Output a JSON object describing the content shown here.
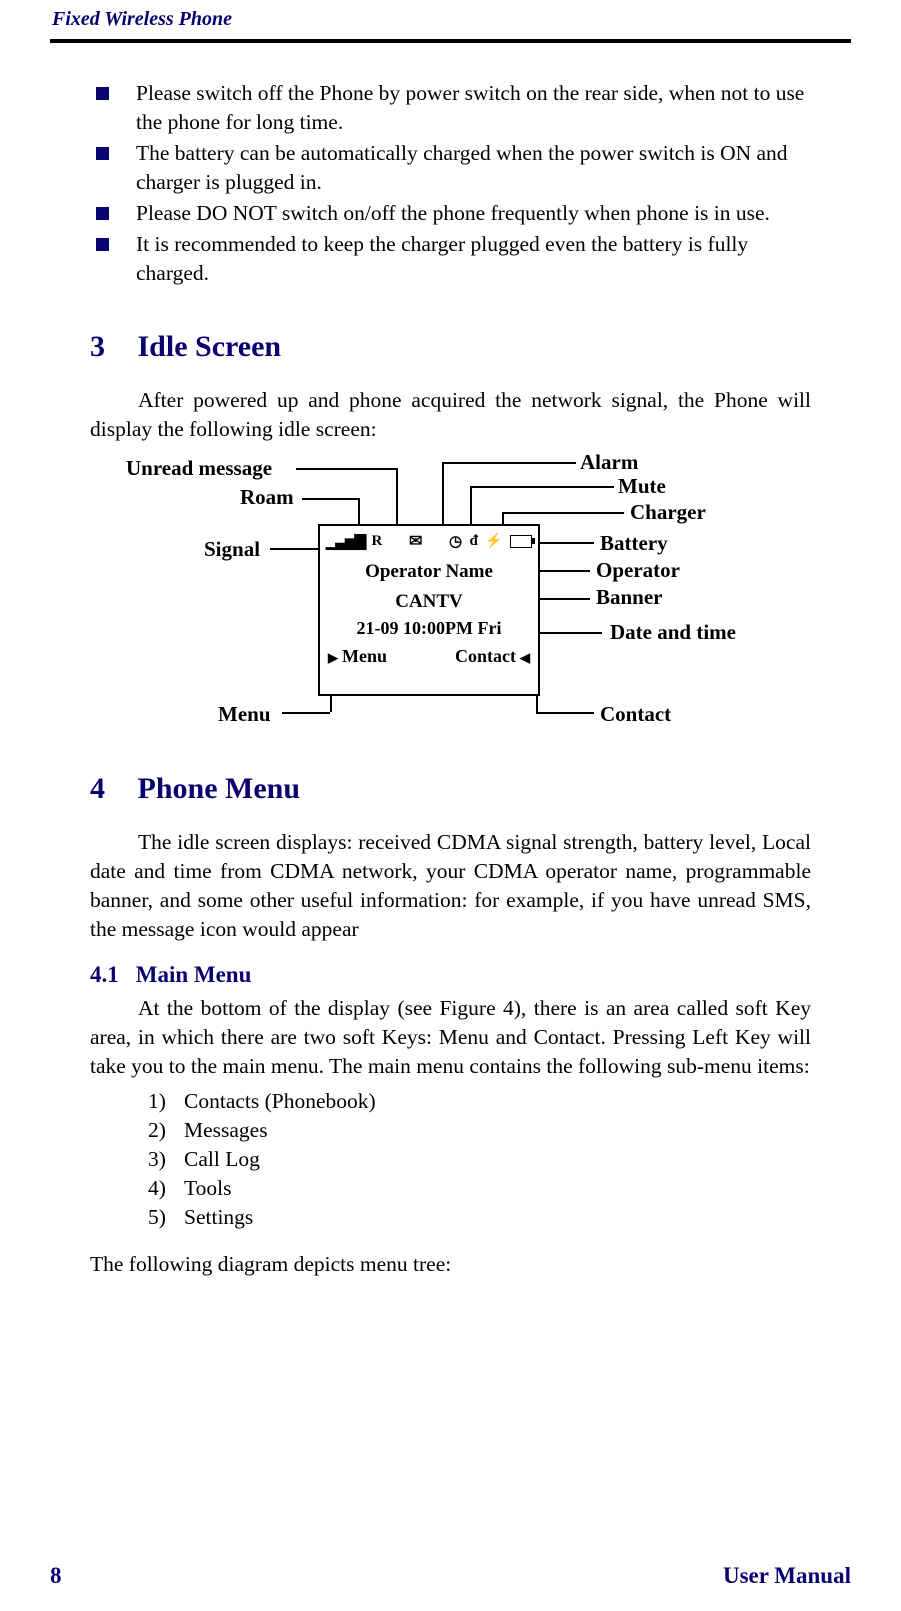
{
  "header": {
    "title": "Fixed Wireless Phone"
  },
  "bullets": [
    "Please switch off the Phone by power switch on the rear side, when not to use the phone for long time.",
    "The battery can be automatically charged when the power switch is ON and charger is plugged in.",
    "Please DO NOT switch on/off the phone frequently when phone is in use.",
    "It is recommended to keep the charger plugged even the battery is fully charged."
  ],
  "section3": {
    "number": "3",
    "title": "Idle Screen",
    "intro": "After powered up and phone acquired the network signal, the Phone will display the following idle screen:"
  },
  "diagram": {
    "labels": {
      "unread": "Unread message",
      "roam": "Roam",
      "signal": "Signal",
      "menu": "Menu",
      "alarm": "Alarm",
      "mute": "Mute",
      "charger": "Charger",
      "battery": "Battery",
      "operator": "Operator",
      "banner": "Banner",
      "datetime": "Date and time",
      "contact": "Contact"
    },
    "screen": {
      "operator_row": "Operator Name",
      "banner_row": "CANTV",
      "datetime_row": "21-09 10:00PM Fri",
      "soft_left": "Menu",
      "soft_right": "Contact"
    }
  },
  "section4": {
    "number": "4",
    "title": "Phone Menu",
    "intro": "The idle screen displays: received CDMA signal strength, battery level, Local date and time from CDMA network, your CDMA operator name, programmable banner, and some other useful information: for example,  if you have unread SMS, the message icon would appear"
  },
  "section41": {
    "number": "4.1",
    "title": "Main Menu",
    "para": "At the bottom of the display (see Figure 4), there is an area called soft Key area, in which there are two soft Keys: Menu and Contact.  Pressing Left Key will take you to the main menu. The main menu contains the following sub-menu items:",
    "items": [
      {
        "n": "1)",
        "t": "Contacts (Phonebook)"
      },
      {
        "n": "2)",
        "t": "Messages"
      },
      {
        "n": "3)",
        "t": "Call Log"
      },
      {
        "n": "4)",
        "t": "Tools"
      },
      {
        "n": "5)",
        "t": "Settings"
      }
    ],
    "trailer": "The following diagram depicts  menu tree:"
  },
  "footer": {
    "page": "8",
    "label": "User Manual"
  }
}
